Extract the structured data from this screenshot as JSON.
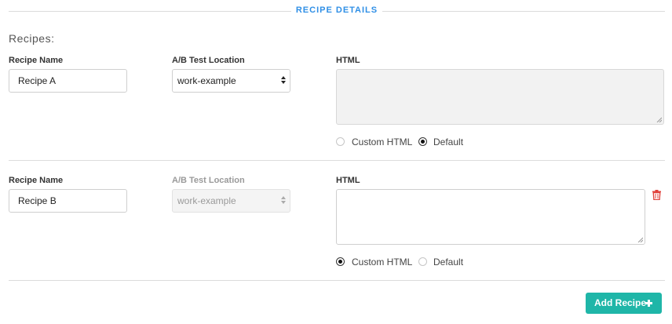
{
  "section": {
    "title": "RECIPE DETAILS"
  },
  "recipes_label": "Recipes:",
  "recipes": [
    {
      "name_label": "Recipe Name",
      "name_value": "Recipe A",
      "location_label": "A/B Test Location",
      "location_value": "work-example",
      "location_disabled": false,
      "html_label": "HTML",
      "html_value": "",
      "html_disabled": true,
      "radio_custom_label": "Custom HTML",
      "radio_default_label": "Default",
      "selected": "default"
    },
    {
      "name_label": "Recipe Name",
      "name_value": "Recipe B",
      "location_label": "A/B Test Location",
      "location_value": "work-example",
      "location_disabled": true,
      "html_label": "HTML",
      "html_value": "",
      "html_disabled": false,
      "radio_custom_label": "Custom HTML",
      "radio_default_label": "Default",
      "selected": "custom",
      "deletable": true
    }
  ],
  "add_button": {
    "label": "Add Recipe",
    "icon": "plus-icon"
  },
  "colors": {
    "accent": "#2f8fe6",
    "button": "#1fb6a8",
    "delete": "#e0413b"
  }
}
